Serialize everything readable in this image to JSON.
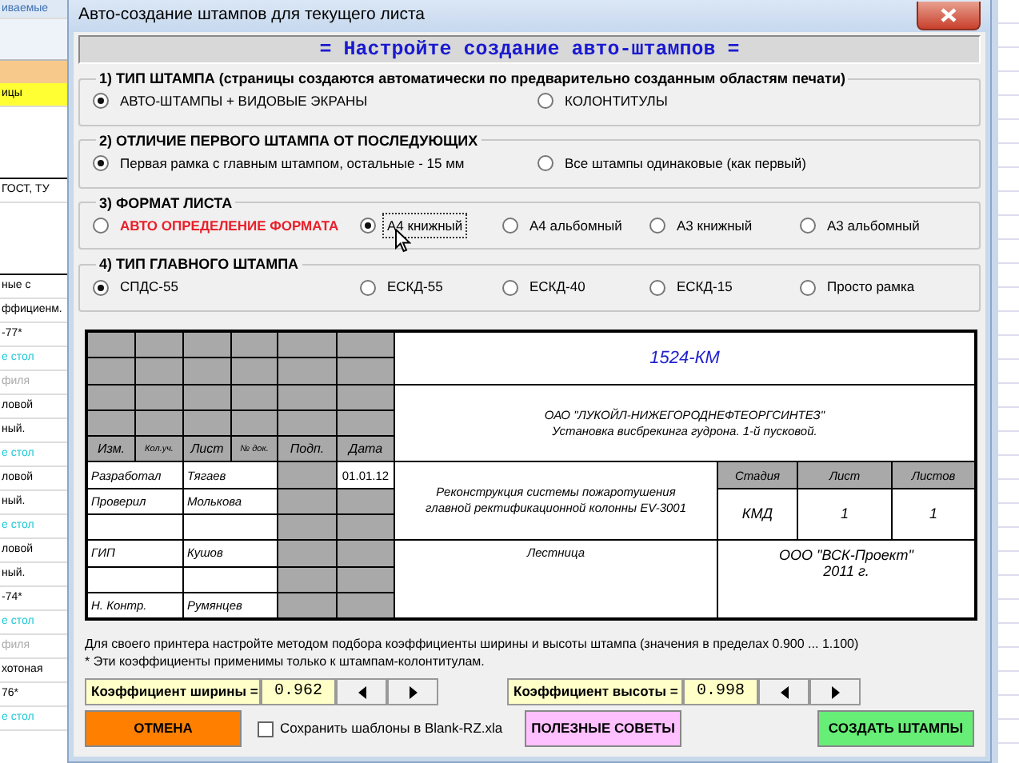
{
  "window": {
    "title": "Авто-создание штампов для текущего листа"
  },
  "header": "= Настройте создание авто-штампов =",
  "groups": [
    {
      "title": "1) ТИП ШТАМПА (страницы создаются автоматически по предварительно созданным областям печати)",
      "options": [
        {
          "label": "АВТО-ШТАМПЫ + ВИДОВЫЕ ЭКРАНЫ",
          "selected": true
        },
        {
          "label": "КОЛОНТИТУЛЫ",
          "selected": false
        }
      ]
    },
    {
      "title": "2) ОТЛИЧИЕ ПЕРВОГО ШТАМПА ОТ ПОСЛЕДУЮЩИХ",
      "options": [
        {
          "label": "Первая рамка с главным штампом, остальные - 15 мм",
          "selected": true
        },
        {
          "label": "Все штампы одинаковые (как первый)",
          "selected": false
        }
      ]
    },
    {
      "title": "3) ФОРМАТ ЛИСТА",
      "options": [
        {
          "label": "АВТО ОПРЕДЕЛЕНИЕ ФОРМАТА",
          "selected": false,
          "color": "#e8202a"
        },
        {
          "label": "А4 книжный",
          "selected": true,
          "focused": true
        },
        {
          "label": "А4 альбомный",
          "selected": false
        },
        {
          "label": "А3 книжный",
          "selected": false
        },
        {
          "label": "А3 альбомный",
          "selected": false
        }
      ]
    },
    {
      "title": "4) ТИП ГЛАВНОГО ШТАМПА",
      "options": [
        {
          "label": "СПДС-55",
          "selected": true
        },
        {
          "label": "ЕСКД-55",
          "selected": false
        },
        {
          "label": "ЕСКД-40",
          "selected": false
        },
        {
          "label": "ЕСКД-15",
          "selected": false
        },
        {
          "label": "Просто рамка",
          "selected": false
        }
      ]
    }
  ],
  "stamp": {
    "code": "1524-КМ",
    "customer": [
      "ОАО \"ЛУКОЙЛ-НИЖЕГОРОДНЕФТЕОРГСИНТЕЗ\"",
      "Установка висбрекинга гудрона. 1-й пусковой."
    ],
    "header_cells": [
      "Изм.",
      "Кол.уч.",
      "Лист",
      "№ док.",
      "Подп.",
      "Дата"
    ],
    "signers": [
      {
        "role": "Разработал",
        "name": "Тягаев",
        "date": "01.01.12"
      },
      {
        "role": "Проверил",
        "name": "Молькова"
      },
      {
        "role": "ГИП",
        "name": "Кушов"
      },
      {
        "role": "Н. Контр.",
        "name": "Румянцев"
      }
    ],
    "description": [
      "Реконструкция системы пожаротушения",
      "главной ректификационной колонны EV-3001"
    ],
    "stage_table": {
      "columns": [
        "Стадия",
        "Лист",
        "Листов"
      ],
      "values": [
        "КМД",
        "1",
        "1"
      ]
    },
    "sheet_name": "Лестница",
    "organization": [
      "ООО \"ВСК-Проект\"",
      "2011 г."
    ]
  },
  "notes": [
    "Для своего принтера настройте методом подбора коэффициенты ширины и высоты штампа (значения в пределах 0.900 ... 1.100)",
    "* Эти коэффициенты применимы только к штампам-колонтитулам."
  ],
  "coefficients": [
    {
      "label": "Коэффициент ширины =",
      "value": "0.962"
    },
    {
      "label": "Коэффициент высоты =",
      "value": "0.998"
    }
  ],
  "buttons": [
    {
      "kind": "cancel",
      "label": "ОТМЕНА"
    },
    {
      "kind": "checkbox",
      "label": "Сохранить шаблоны в Blank-RZ.xla",
      "checked": false
    },
    {
      "kind": "tips",
      "label": "ПОЛЕЗНЫЕ СОВЕТЫ"
    },
    {
      "kind": "create",
      "label": "СОЗДАТЬ ШТАМПЫ"
    }
  ],
  "background_sheet": [
    {
      "text": "иваемые",
      "kind": "ribbon"
    },
    {
      "text": "ицы",
      "kind": "yellow"
    },
    {
      "text": "ГОСТ, ТУ",
      "kind": "plain"
    },
    {
      "text": "ные с",
      "kind": "plain"
    },
    {
      "text": "ффициенм.",
      "kind": "plain"
    },
    {
      "text": "-77*",
      "kind": "plain"
    },
    {
      "text": "е стол",
      "kind": "link"
    },
    {
      "text": "филя",
      "kind": "muted"
    },
    {
      "text": "ловой",
      "kind": "plain"
    },
    {
      "text": "ный.",
      "kind": "plain"
    },
    {
      "text": "е стол",
      "kind": "link"
    },
    {
      "text": "ловой",
      "kind": "plain"
    },
    {
      "text": "ный.",
      "kind": "plain"
    },
    {
      "text": "е стол",
      "kind": "link"
    },
    {
      "text": "ловой",
      "kind": "plain"
    },
    {
      "text": "ный.",
      "kind": "plain"
    },
    {
      "text": "-74*",
      "kind": "plain"
    },
    {
      "text": "е стол",
      "kind": "link"
    },
    {
      "text": "филя",
      "kind": "muted"
    },
    {
      "text": "хотоная",
      "kind": "plain"
    },
    {
      "text": "76*",
      "kind": "plain"
    },
    {
      "text": "е стол",
      "kind": "link"
    }
  ]
}
